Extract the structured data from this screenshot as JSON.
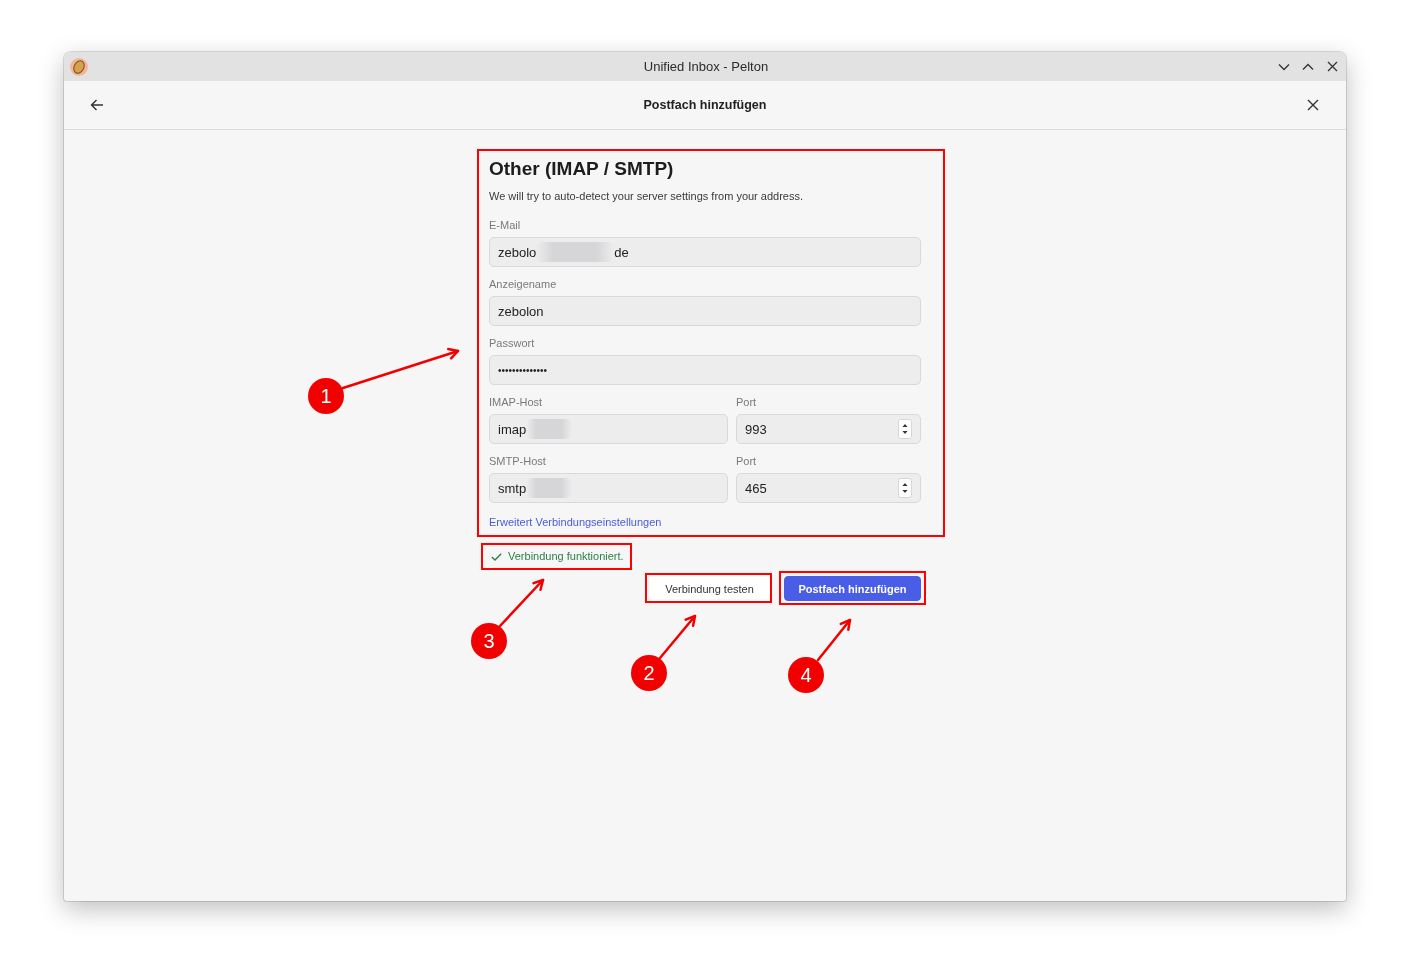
{
  "window": {
    "title": "Unified Inbox - Pelton"
  },
  "header": {
    "title": "Postfach hinzufügen"
  },
  "form": {
    "highlighted": true,
    "title": "Other (IMAP / SMTP)",
    "description": "We will try to auto-detect your server settings from your address.",
    "fields": [
      {
        "kind": "text",
        "label": "E-Mail",
        "value": "zebolo",
        "redacted": true,
        "value_tail": "de"
      },
      {
        "kind": "text",
        "label": "Anzeigename",
        "value": "zebolon",
        "redacted": false
      },
      {
        "kind": "password",
        "label": "Passwort",
        "value": "••••••••••••••",
        "redacted": false
      }
    ],
    "servers": [
      {
        "host_label": "IMAP-Host",
        "host_value": "imap",
        "host_redacted": true,
        "port_label": "Port",
        "port_value": "993"
      },
      {
        "host_label": "SMTP-Host",
        "host_value": "smtp",
        "host_redacted": true,
        "port_label": "Port",
        "port_value": "465"
      }
    ],
    "advanced_link": "Erweitert Verbindungseinstellungen"
  },
  "status": {
    "text": "Verbindung funktioniert.",
    "highlighted": true
  },
  "buttons": [
    {
      "label": "Verbindung testen",
      "kind": "secondary",
      "highlighted": true
    },
    {
      "label": "Postfach hinzufügen",
      "kind": "primary",
      "highlighted": true
    }
  ],
  "annotations": [
    {
      "label": "1"
    },
    {
      "label": "2"
    },
    {
      "label": "3"
    },
    {
      "label": "4"
    }
  ]
}
